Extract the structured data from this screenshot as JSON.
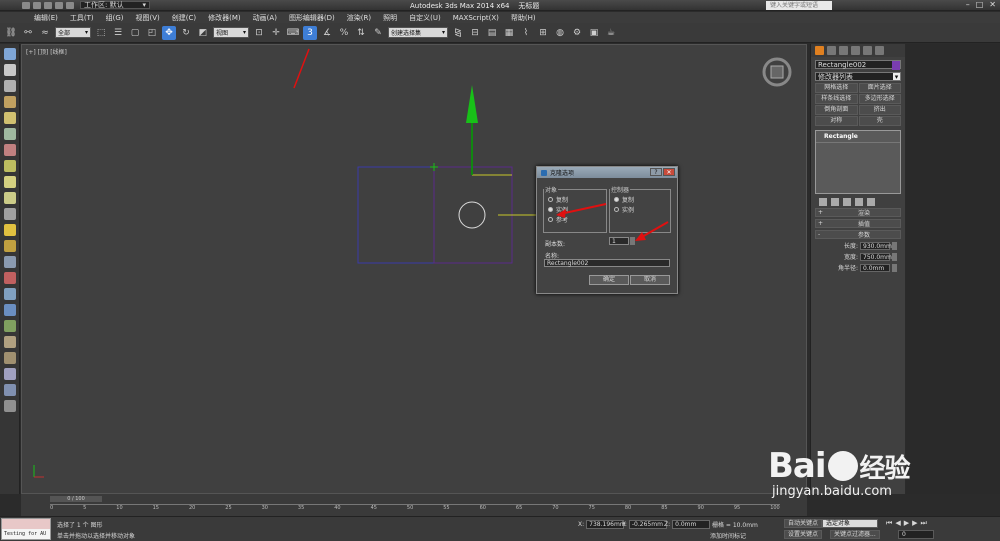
{
  "titlebar": {
    "workspace": "工作区: 默认",
    "app_title": "Autodesk 3ds Max  2014 x64",
    "file_title": "无标题",
    "search_placeholder": "键入关键字或短语"
  },
  "menu": [
    "编辑(E)",
    "工具(T)",
    "组(G)",
    "视图(V)",
    "创建(C)",
    "修改器(M)",
    "动画(A)",
    "图形编辑器(D)",
    "渲染(R)",
    "照明",
    "自定义(U)",
    "MAXScript(X)",
    "帮助(H)"
  ],
  "toolbar": {
    "selection_filter": "全部",
    "ref_coord": "视图",
    "named_selection": "创建选择集"
  },
  "viewport": {
    "label": "[+] [顶] [线框]"
  },
  "dialog": {
    "title": "克隆选项",
    "object_group": "对象",
    "object_options": [
      {
        "label": "复制",
        "selected": false
      },
      {
        "label": "实例",
        "selected": true
      },
      {
        "label": "参考",
        "selected": false
      }
    ],
    "controller_group": "控制器",
    "controller_options": [
      {
        "label": "复制",
        "selected": true
      },
      {
        "label": "实例",
        "selected": false
      }
    ],
    "copies_label": "副本数:",
    "copies_value": "1",
    "name_label": "名称:",
    "name_value": "Rectangle002",
    "ok_label": "确定",
    "cancel_label": "取消"
  },
  "command_panel": {
    "object_name": "Rectangle002",
    "object_color": "#7a3db0",
    "modifier_list": "修改器列表",
    "buttons": [
      "网格选择",
      "面片选择",
      "样条线选择",
      "多边形选择",
      "倒角剖面",
      "挤出",
      "对称",
      "壳"
    ],
    "stack_item": "Rectangle",
    "rollouts": [
      {
        "sign": "+",
        "label": "渲染"
      },
      {
        "sign": "+",
        "label": "插值"
      },
      {
        "sign": "-",
        "label": "参数"
      }
    ],
    "params": [
      {
        "label": "长度:",
        "value": "930.0mm"
      },
      {
        "label": "宽度:",
        "value": "750.0mm"
      },
      {
        "label": "角半径:",
        "value": "0.0mm"
      }
    ]
  },
  "timeline": {
    "frame_slider": "0 / 100",
    "ticks": [
      "0",
      "5",
      "10",
      "15",
      "20",
      "25",
      "30",
      "35",
      "40",
      "45",
      "50",
      "55",
      "60",
      "65",
      "70",
      "75",
      "80",
      "85",
      "90",
      "95",
      "100"
    ]
  },
  "status": {
    "testing_label": "Testing for AU",
    "selected_text": "选择了 1 个 图形",
    "prompt_text": "单击并拖动以选择并移动对象",
    "x_label": "X:",
    "x_value": "738.196mm",
    "y_label": "Y:",
    "y_value": "-0.265mm",
    "z_label": "Z:",
    "z_value": "0.0mm",
    "grid_text": "栅格 = 10.0mm",
    "add_time_tag": "添加时间标记",
    "auto_key": "自动关键点",
    "selected_obj": "选定对象",
    "set_key": "设置关键点",
    "key_filters": "关键点过滤器...",
    "frame_value": "0"
  },
  "watermark": {
    "brand": "Bai",
    "brand_cn": "经验",
    "url": "jingyan.baidu.com"
  }
}
